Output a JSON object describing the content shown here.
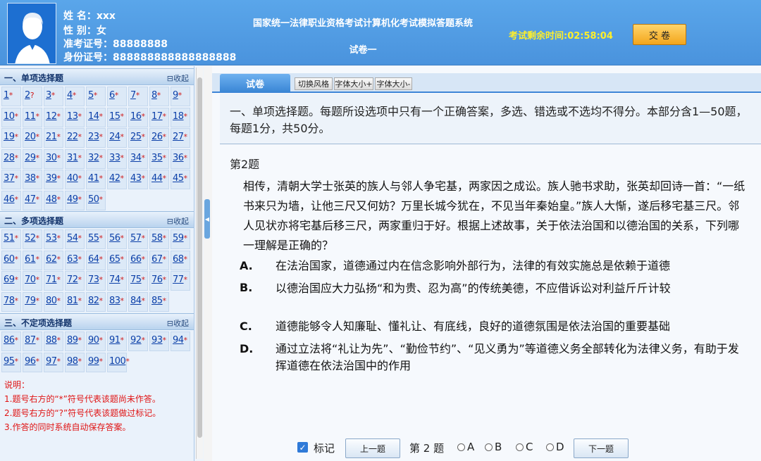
{
  "candidate": {
    "name_label": "姓 名：",
    "name": "xxx",
    "gender_label": "性 别：",
    "gender": "女",
    "ticket_label": "准考证号：",
    "ticket": "88888888",
    "id_label": "身份证号：",
    "id": "888888888888888888"
  },
  "header": {
    "system_title": "国家统一法律职业资格考试计算机化考试模拟答题系统",
    "paper_title": "试卷一",
    "timer_label": "考试剩余时间:",
    "timer_value": "02:58:04",
    "submit_label": "交 卷"
  },
  "sections": [
    {
      "title": "一、单项选择题",
      "collapse": "⊟收起",
      "questions": [
        {
          "n": "1",
          "m": "*"
        },
        {
          "n": "2",
          "m": "?"
        },
        {
          "n": "3",
          "m": "*"
        },
        {
          "n": "4",
          "m": "*"
        },
        {
          "n": "5",
          "m": "*"
        },
        {
          "n": "6",
          "m": "*"
        },
        {
          "n": "7",
          "m": "*"
        },
        {
          "n": "8",
          "m": "*"
        },
        {
          "n": "9",
          "m": "*"
        },
        {
          "n": "10",
          "m": "*"
        },
        {
          "n": "11",
          "m": "*"
        },
        {
          "n": "12",
          "m": "*"
        },
        {
          "n": "13",
          "m": "*"
        },
        {
          "n": "14",
          "m": "*"
        },
        {
          "n": "15",
          "m": "*"
        },
        {
          "n": "16",
          "m": "*"
        },
        {
          "n": "17",
          "m": "*"
        },
        {
          "n": "18",
          "m": "*"
        },
        {
          "n": "19",
          "m": "*"
        },
        {
          "n": "20",
          "m": "*"
        },
        {
          "n": "21",
          "m": "*"
        },
        {
          "n": "22",
          "m": "*"
        },
        {
          "n": "23",
          "m": "*"
        },
        {
          "n": "24",
          "m": "*"
        },
        {
          "n": "25",
          "m": "*"
        },
        {
          "n": "26",
          "m": "*"
        },
        {
          "n": "27",
          "m": "*"
        },
        {
          "n": "28",
          "m": "*"
        },
        {
          "n": "29",
          "m": "*"
        },
        {
          "n": "30",
          "m": "*"
        },
        {
          "n": "31",
          "m": "*"
        },
        {
          "n": "32",
          "m": "*"
        },
        {
          "n": "33",
          "m": "*"
        },
        {
          "n": "34",
          "m": "*"
        },
        {
          "n": "35",
          "m": "*"
        },
        {
          "n": "36",
          "m": "*"
        },
        {
          "n": "37",
          "m": "*"
        },
        {
          "n": "38",
          "m": "*"
        },
        {
          "n": "39",
          "m": "*"
        },
        {
          "n": "40",
          "m": "*"
        },
        {
          "n": "41",
          "m": "*"
        },
        {
          "n": "42",
          "m": "*"
        },
        {
          "n": "43",
          "m": "*"
        },
        {
          "n": "44",
          "m": "*"
        },
        {
          "n": "45",
          "m": "*"
        },
        {
          "n": "46",
          "m": "*"
        },
        {
          "n": "47",
          "m": "*"
        },
        {
          "n": "48",
          "m": "*"
        },
        {
          "n": "49",
          "m": "*"
        },
        {
          "n": "50",
          "m": "*"
        }
      ]
    },
    {
      "title": "二、多项选择题",
      "collapse": "⊟收起",
      "questions": [
        {
          "n": "51",
          "m": "*"
        },
        {
          "n": "52",
          "m": "*"
        },
        {
          "n": "53",
          "m": "*"
        },
        {
          "n": "54",
          "m": "*"
        },
        {
          "n": "55",
          "m": "*"
        },
        {
          "n": "56",
          "m": "*"
        },
        {
          "n": "57",
          "m": "*"
        },
        {
          "n": "58",
          "m": "*"
        },
        {
          "n": "59",
          "m": "*"
        },
        {
          "n": "60",
          "m": "*"
        },
        {
          "n": "61",
          "m": "*"
        },
        {
          "n": "62",
          "m": "*"
        },
        {
          "n": "63",
          "m": "*"
        },
        {
          "n": "64",
          "m": "*"
        },
        {
          "n": "65",
          "m": "*"
        },
        {
          "n": "66",
          "m": "*"
        },
        {
          "n": "67",
          "m": "*"
        },
        {
          "n": "68",
          "m": "*"
        },
        {
          "n": "69",
          "m": "*"
        },
        {
          "n": "70",
          "m": "*"
        },
        {
          "n": "71",
          "m": "*"
        },
        {
          "n": "72",
          "m": "*"
        },
        {
          "n": "73",
          "m": "*"
        },
        {
          "n": "74",
          "m": "*"
        },
        {
          "n": "75",
          "m": "*"
        },
        {
          "n": "76",
          "m": "*"
        },
        {
          "n": "77",
          "m": "*"
        },
        {
          "n": "78",
          "m": "*"
        },
        {
          "n": "79",
          "m": "*"
        },
        {
          "n": "80",
          "m": "*"
        },
        {
          "n": "81",
          "m": "*"
        },
        {
          "n": "82",
          "m": "*"
        },
        {
          "n": "83",
          "m": "*"
        },
        {
          "n": "84",
          "m": "*"
        },
        {
          "n": "85",
          "m": "*"
        }
      ]
    },
    {
      "title": "三、不定项选择题",
      "collapse": "⊟收起",
      "questions": [
        {
          "n": "86",
          "m": "*"
        },
        {
          "n": "87",
          "m": "*"
        },
        {
          "n": "88",
          "m": "*"
        },
        {
          "n": "89",
          "m": "*"
        },
        {
          "n": "90",
          "m": "*"
        },
        {
          "n": "91",
          "m": "*"
        },
        {
          "n": "92",
          "m": "*"
        },
        {
          "n": "93",
          "m": "*"
        },
        {
          "n": "94",
          "m": "*"
        },
        {
          "n": "95",
          "m": "*"
        },
        {
          "n": "96",
          "m": "*"
        },
        {
          "n": "97",
          "m": "*"
        },
        {
          "n": "98",
          "m": "*"
        },
        {
          "n": "99",
          "m": "*"
        },
        {
          "n": "100",
          "m": "*"
        }
      ]
    }
  ],
  "notes": [
    "说明：",
    "1.题号右方的“*”符号代表该题尚未作答。",
    "2.题号右方的“?”符号代表该题做过标记。",
    "3.作答的同时系统自动保存答案。"
  ],
  "tabs": {
    "paper": "试卷",
    "switch_style": "切换风格",
    "font_up": "字体大小+",
    "font_down": "字体大小-"
  },
  "intro": "一、单项选择题。每题所设选项中只有一个正确答案，多选、错选或不选均不得分。本部分含1—50题，每题1分，共50分。",
  "question": {
    "number_label": "第2题",
    "stem": "相传，清朝大学士张英的族人与邻人争宅基，两家因之成讼。族人驰书求助，张英却回诗一首：“一纸书来只为墙，让他三尺又何妨？万里长城今犹在，不见当年秦始皇。”族人大惭，遂后移宅基三尺。邻人见状亦将宅基后移三尺，两家重归于好。根据上述故事，关于依法治国和以德治国的关系，下列哪一理解是正确的？",
    "options": [
      {
        "letter": "A.",
        "text": "在法治国家，道德通过内在信念影响外部行为，法律的有效实施总是依赖于道德"
      },
      {
        "letter": "B.",
        "text": "以德治国应大力弘扬“和为贵、忍为高”的传统美德，不应借诉讼对利益斤斤计较"
      },
      {
        "letter": "C.",
        "text": "道德能够令人知廉耻、懂礼让、有底线，良好的道德氛围是依法治国的重要基础"
      },
      {
        "letter": "D.",
        "text": "通过立法将“礼让为先”、“勤俭节约”、“见义勇为”等道德义务全部转化为法律义务，有助于发挥道德在依法治国中的作用"
      }
    ]
  },
  "bottom_nav": {
    "mark_label": "标记",
    "mark_checked": true,
    "prev_label": "上一题",
    "qno_label": "第 2 题",
    "choices": [
      "A",
      "B",
      "C",
      "D"
    ],
    "next_label": "下一题"
  }
}
